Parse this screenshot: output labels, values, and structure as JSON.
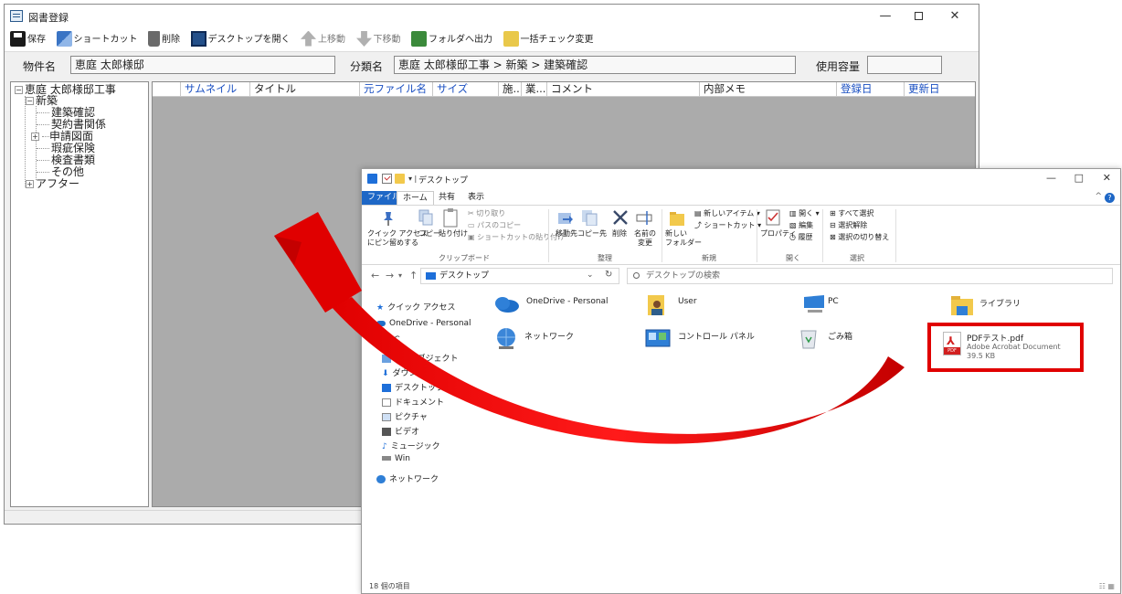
{
  "app": {
    "title": "図書登録",
    "window_controls": {
      "minimize": "—",
      "maximize": "□",
      "close": "✕"
    },
    "toolbar": {
      "save": "保存",
      "shortcut": "ショートカット",
      "delete": "削除",
      "open_desktop": "デスクトップを開く",
      "move_up": "上移動",
      "move_down": "下移動",
      "export_folder": "フォルダへ出力",
      "bulk_check": "一括チェック変更"
    },
    "info": {
      "property_label": "物件名",
      "property_value": "恵庭 太郎様邸",
      "category_label": "分類名",
      "category_value": "恵庭 太郎様邸工事 > 新築 > 建築確認",
      "usage_label": "使用容量",
      "usage_value": ""
    },
    "tree": {
      "root": "恵庭 太郎様邸工事",
      "new_build": "新築",
      "children": [
        "建築確認",
        "契約書関係",
        "申請図面",
        "瑕疵保険",
        "検査書類",
        "その他"
      ],
      "after": "アフター"
    },
    "columns": [
      "サムネイル",
      "タイトル",
      "元ファイル名",
      "サイズ",
      "施...",
      "業...",
      "コメント",
      "内部メモ",
      "登録日",
      "更新日"
    ]
  },
  "explorer": {
    "title": "デスクトップ",
    "quick_access_arrow": "▾ |",
    "window_controls": {
      "minimize": "—",
      "maximize": "□",
      "close": "✕"
    },
    "tabs": {
      "file": "ファイル",
      "home": "ホーム",
      "share": "共有",
      "view": "表示"
    },
    "collapse_chevron": "^",
    "help": "?",
    "ribbon": {
      "pin_quick_line1": "クイック アクセス",
      "pin_quick_line2": "にピン留めする",
      "copy": "コピー",
      "paste": "貼り付け",
      "cut": "切り取り",
      "copy_path": "パスのコピー",
      "paste_shortcut": "ショートカットの貼り付け",
      "clipboard_group": "クリップボード",
      "move_to": "移動先",
      "copy_to": "コピー先",
      "delete": "削除",
      "rename_line1": "名前の",
      "rename_line2": "変更",
      "organize_group": "整理",
      "new_item": "新しいアイテム ▾",
      "shortcut": "ショートカット ▾",
      "new_folder_line1": "新しい",
      "new_folder_line2": "フォルダー",
      "new_group": "新規",
      "properties": "プロパティ",
      "open": "開く ▾",
      "edit": "編集",
      "history": "履歴",
      "open_group": "開く",
      "select_all": "すべて選択",
      "select_none": "選択解除",
      "invert_selection": "選択の切り替え",
      "select_group": "選択"
    },
    "nav_buttons": {
      "back": "←",
      "forward": "→",
      "recent": "▾",
      "up": "↑"
    },
    "address": "デスクトップ",
    "address_dropdown": "⌄",
    "refresh": "↻",
    "search_placeholder": "デスクトップの検索",
    "nav_pane": {
      "quick_access": "クイック アクセス",
      "onedrive": "OneDrive - Personal",
      "pc_partial": "PC",
      "objects_3d": "3D オブジェクト",
      "downloads": "ダウンロード",
      "desktop": "デスクトップ",
      "documents": "ドキュメント",
      "pictures": "ピクチャ",
      "videos": "ビデオ",
      "music": "ミュージック",
      "win": "Win",
      "network": "ネットワーク"
    },
    "items": {
      "onedrive": "OneDrive - Personal",
      "user": "User",
      "pc": "PC",
      "library": "ライブラリ",
      "network": "ネットワーク",
      "control_panel": "コントロール パネル",
      "recycle": "ごみ箱",
      "pdf_name": "PDFテスト.pdf",
      "pdf_type": "Adobe Acrobat Document",
      "pdf_size": "39.5 KB"
    },
    "status": "18 個の項目",
    "view_buttons": "☷ ▦"
  },
  "colors": {
    "accent_blue": "#1e67c6",
    "header_blue_text": "#1a4fc2",
    "highlight_red": "#e00000",
    "arrow_red": "#e00000",
    "grid_gray": "#ababab"
  }
}
